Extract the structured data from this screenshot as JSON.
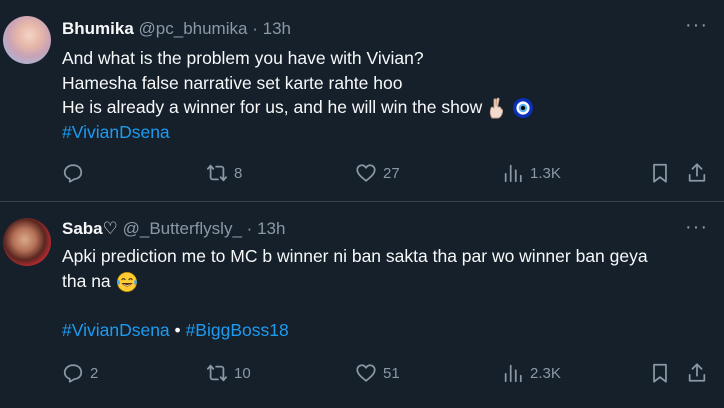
{
  "tweets": [
    {
      "name": "Bhumika",
      "handle": "@pc_bhumika",
      "dot": "·",
      "time": "13h",
      "more": "···",
      "lines": [
        "And what is the problem you have  with Vivian?",
        "Hamesha false narrative set karte rahte hoo",
        "He is already a winner for us, and he will win the show"
      ],
      "hashtags": [
        "#VivianDsena"
      ],
      "counts": {
        "replies": "",
        "retweets": "8",
        "likes": "27",
        "views": "1.3K"
      }
    },
    {
      "name": "Saba♡",
      "handle": "@_Butterflysly_",
      "dot": "·",
      "time": "13h",
      "more": "···",
      "lines": [
        "Apki prediction me to MC b winner ni ban sakta tha par wo winner ban geya",
        "tha na"
      ],
      "hashtags": [
        "#VivianDsena",
        "#BiggBoss18"
      ],
      "hashtag_sep": "•",
      "counts": {
        "replies": "2",
        "retweets": "10",
        "likes": "51",
        "views": "2.3K"
      }
    }
  ],
  "icons": {
    "reply": "reply-icon",
    "retweet": "retweet-icon",
    "like": "heart-icon",
    "views": "views-icon",
    "bookmark": "bookmark-icon",
    "share": "share-icon",
    "emoji_fingers": "crossed-fingers-emoji",
    "emoji_evil_eye": "nazar-amulet-emoji",
    "emoji_laugh": "tears-of-joy-emoji"
  },
  "colors": {
    "background": "#15202b",
    "text": "#f7f9f9",
    "muted": "#8b98a5",
    "link": "#1d9bf0",
    "divider": "#38444d"
  }
}
